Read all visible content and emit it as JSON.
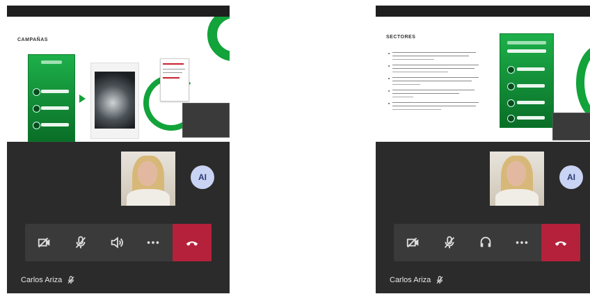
{
  "left_panel": {
    "slide_title": "CAMPAÑAS",
    "avatar_initials": "AI",
    "participant_name": "Carlos Ariza",
    "controls": [
      "camera-off",
      "mic-off",
      "speaker",
      "more",
      "hang-up"
    ]
  },
  "right_panel": {
    "slide_title": "SECTORES",
    "avatar_initials": "AI",
    "participant_name": "Carlos Ariza",
    "controls": [
      "camera-off",
      "mic-off",
      "headset",
      "more",
      "hang-up"
    ]
  },
  "colors": {
    "brand_green": "#12a33a",
    "hangup_red": "#b5213a",
    "avatar_bg": "#c9d3f3",
    "call_bg": "#2b2b2b"
  }
}
